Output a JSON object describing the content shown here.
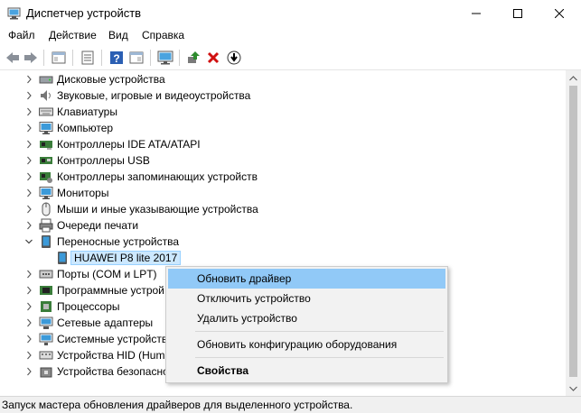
{
  "window": {
    "title": "Диспетчер устройств",
    "min_icon": "minimize-icon",
    "max_icon": "maximize-icon",
    "close_icon": "close-icon"
  },
  "menu": [
    "Файл",
    "Действие",
    "Вид",
    "Справка"
  ],
  "tree": {
    "items": [
      {
        "label": "Дисковые устройства",
        "icon": "disk-drive-icon",
        "expanded": false
      },
      {
        "label": "Звуковые, игровые и видеоустройства",
        "icon": "speaker-icon",
        "expanded": false
      },
      {
        "label": "Клавиатуры",
        "icon": "keyboard-icon",
        "expanded": false
      },
      {
        "label": "Компьютер",
        "icon": "monitor-icon",
        "expanded": false
      },
      {
        "label": "Контроллеры IDE ATA/ATAPI",
        "icon": "ide-controller-icon",
        "expanded": false
      },
      {
        "label": "Контроллеры USB",
        "icon": "usb-icon",
        "expanded": false
      },
      {
        "label": "Контроллеры запоминающих устройств",
        "icon": "storage-controller-icon",
        "expanded": false
      },
      {
        "label": "Мониторы",
        "icon": "monitor-icon",
        "expanded": false
      },
      {
        "label": "Мыши и иные указывающие устройства",
        "icon": "mouse-icon",
        "expanded": false
      },
      {
        "label": "Очереди печати",
        "icon": "printer-icon",
        "expanded": false
      },
      {
        "label": "Переносные устройства",
        "icon": "portable-device-icon",
        "expanded": true
      },
      {
        "label": "HUAWEI P8 lite 2017",
        "icon": "phone-icon",
        "child": true,
        "selected": true
      },
      {
        "label": "Порты (COM и LPT)",
        "icon": "port-icon",
        "expanded": false
      },
      {
        "label": "Программные устрой",
        "icon": "software-device-icon",
        "expanded": false
      },
      {
        "label": "Процессоры",
        "icon": "cpu-icon",
        "expanded": false
      },
      {
        "label": "Сетевые адаптеры",
        "icon": "network-adapter-icon",
        "expanded": false
      },
      {
        "label": "Системные устройств",
        "icon": "system-device-icon",
        "expanded": false
      },
      {
        "label": "Устройства HID (Hum",
        "icon": "hid-icon",
        "expanded": false
      },
      {
        "label": "Устройства безопасно",
        "icon": "security-device-icon",
        "expanded": false
      }
    ]
  },
  "context_menu": {
    "items": [
      {
        "label": "Обновить драйвер",
        "highlighted": true
      },
      {
        "label": "Отключить устройство"
      },
      {
        "label": "Удалить устройство"
      },
      {
        "label": "Обновить конфигурацию оборудования"
      },
      {
        "label": "Свойства",
        "bold": true
      }
    ]
  },
  "status": "Запуск мастера обновления драйверов для выделенного устройства.",
  "colors": {
    "selection_bg": "#cce8ff",
    "menu_highlight": "#91c9f7",
    "remove_red": "#d01010",
    "update_green": "#2e8b2e"
  }
}
